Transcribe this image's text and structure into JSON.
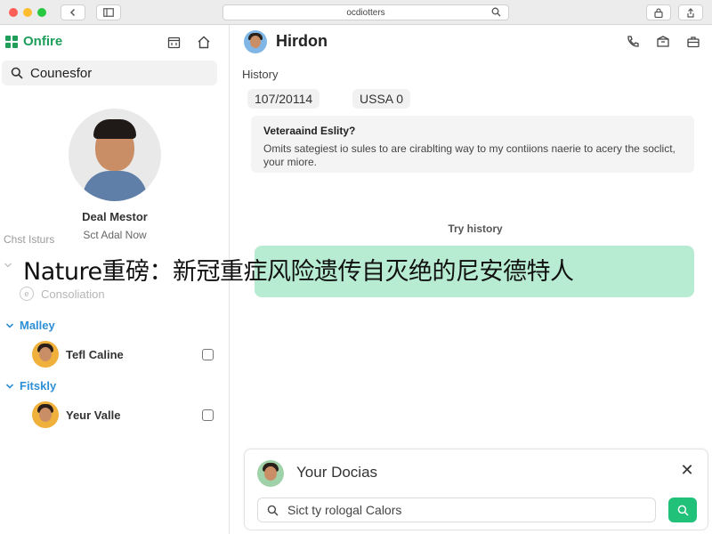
{
  "browser": {
    "address": "ocdiotters"
  },
  "sidebar": {
    "brand": "Onfire",
    "search_label": "Counesfor",
    "profile": {
      "name": "Deal Mestor",
      "subtitle": "Sct Adal Now"
    },
    "section_title": "Chst Isturs",
    "consult_label": "Consoliation",
    "groups": [
      {
        "label": "Malley",
        "contact": "Tefl Caline"
      },
      {
        "label": "Fitskly",
        "contact": "Yeur Valle"
      }
    ]
  },
  "chat": {
    "title": "Hirdon",
    "history_label": "History",
    "chips": [
      "107/20114",
      "USSA  0"
    ],
    "info_title": "Veteraaind Eslity?",
    "info_body": "Omits sategiest io sules to are cirablting way to my contiions naerie to acery the soclict, your miore.",
    "try_history": "Try history"
  },
  "headline": "Nature重磅：新冠重症风险遗传自灭绝的尼安德特人",
  "compose": {
    "title": "Your Docias",
    "input_value": "Sict ty rologal Calors"
  },
  "colors": {
    "brand_green": "#1e9e5a",
    "group_blue": "#2d8fd6",
    "banner_green": "#b8ecd2",
    "send_green": "#22c17a"
  }
}
